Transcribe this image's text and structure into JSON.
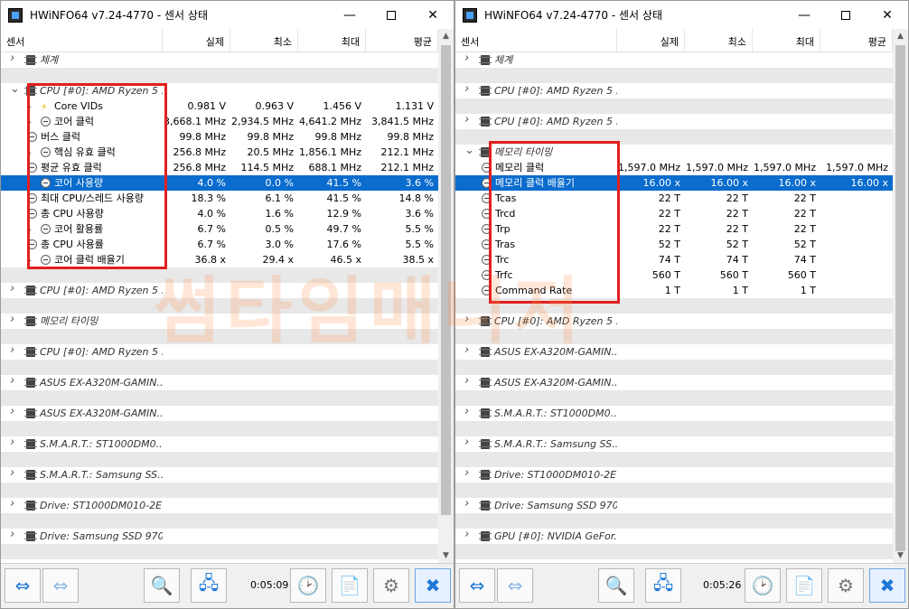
{
  "left": {
    "title": "HWiNFO64 v7.24-4770 - 센서 상태",
    "columns": [
      "센서",
      "실제",
      "최소",
      "최대",
      "평균"
    ],
    "time": "0:05:09",
    "rows": [
      {
        "kind": "group",
        "label": "체계",
        "expand": ">"
      },
      {
        "kind": "gap"
      },
      {
        "kind": "group",
        "label": "CPU [#0]: AMD Ryzen 5 ...",
        "expand": "v"
      },
      {
        "kind": "item",
        "icon": "bolt",
        "indent": 2,
        "label": "Core VIDs",
        "v": [
          "0.981 V",
          "0.963 V",
          "1.456 V",
          "1.131 V"
        ]
      },
      {
        "kind": "item",
        "icon": "circle",
        "indent": 2,
        "label": "코어 클럭",
        "v": [
          "3,668.1 MHz",
          "2,934.5 MHz",
          "4,641.2 MHz",
          "3,841.5 MHz"
        ]
      },
      {
        "kind": "item",
        "icon": "circle",
        "indent": 1,
        "label": "버스 클럭",
        "v": [
          "99.8 MHz",
          "99.8 MHz",
          "99.8 MHz",
          "99.8 MHz"
        ]
      },
      {
        "kind": "item",
        "icon": "circle",
        "indent": 2,
        "label": "핵심 유효 클럭",
        "v": [
          "256.8 MHz",
          "20.5 MHz",
          "1,856.1 MHz",
          "212.1 MHz"
        ]
      },
      {
        "kind": "item",
        "icon": "circle",
        "indent": 1,
        "label": "평균 유효 클럭",
        "v": [
          "256.8 MHz",
          "114.5 MHz",
          "688.1 MHz",
          "212.1 MHz"
        ]
      },
      {
        "kind": "item",
        "icon": "circle",
        "indent": 2,
        "label": "코어 사용량",
        "sel": true,
        "v": [
          "4.0 %",
          "0.0 %",
          "41.5 %",
          "3.6 %"
        ]
      },
      {
        "kind": "item",
        "icon": "circle",
        "indent": 1,
        "label": "최대 CPU/스레드 사용량",
        "v": [
          "18.3 %",
          "6.1 %",
          "41.5 %",
          "14.8 %"
        ]
      },
      {
        "kind": "item",
        "icon": "circle",
        "indent": 1,
        "label": "총 CPU 사용량",
        "v": [
          "4.0 %",
          "1.6 %",
          "12.9 %",
          "3.6 %"
        ]
      },
      {
        "kind": "item",
        "icon": "circle",
        "indent": 2,
        "label": "코어 활용률",
        "v": [
          "6.7 %",
          "0.5 %",
          "49.7 %",
          "5.5 %"
        ]
      },
      {
        "kind": "item",
        "icon": "circle",
        "indent": 1,
        "label": "총 CPU 사용률",
        "v": [
          "6.7 %",
          "3.0 %",
          "17.6 %",
          "5.5 %"
        ]
      },
      {
        "kind": "item",
        "icon": "circle",
        "indent": 2,
        "label": "코어 클럭 배율기",
        "v": [
          "36.8 x",
          "29.4 x",
          "46.5 x",
          "38.5 x"
        ]
      },
      {
        "kind": "gap"
      },
      {
        "kind": "group",
        "label": "CPU [#0]: AMD Ryzen 5 ...",
        "expand": ">"
      },
      {
        "kind": "gap"
      },
      {
        "kind": "group",
        "label": "메모리 타이밍",
        "expand": ">"
      },
      {
        "kind": "gap"
      },
      {
        "kind": "group",
        "label": "CPU [#0]: AMD Ryzen 5 ...",
        "expand": ">"
      },
      {
        "kind": "gap"
      },
      {
        "kind": "group",
        "label": "ASUS EX-A320M-GAMIN...",
        "expand": ">"
      },
      {
        "kind": "gap"
      },
      {
        "kind": "group",
        "label": "ASUS EX-A320M-GAMIN...",
        "expand": ">"
      },
      {
        "kind": "gap"
      },
      {
        "kind": "group",
        "label": "S.M.A.R.T.: ST1000DM0...",
        "expand": ">"
      },
      {
        "kind": "gap"
      },
      {
        "kind": "group",
        "label": "S.M.A.R.T.: Samsung SS...",
        "expand": ">"
      },
      {
        "kind": "gap"
      },
      {
        "kind": "group",
        "label": "Drive: ST1000DM010-2E...",
        "expand": ">"
      },
      {
        "kind": "gap"
      },
      {
        "kind": "group",
        "label": "Drive: Samsung SSD 970 ...",
        "expand": ">"
      },
      {
        "kind": "gap"
      }
    ]
  },
  "right": {
    "title": "HWiNFO64 v7.24-4770 - 센서 상태",
    "columns": [
      "센서",
      "실제",
      "최소",
      "최대",
      "평균"
    ],
    "time": "0:05:26",
    "rows": [
      {
        "kind": "group",
        "label": "체계",
        "expand": ">"
      },
      {
        "kind": "gap"
      },
      {
        "kind": "group",
        "label": "CPU [#0]: AMD Ryzen 5 ...",
        "expand": ">"
      },
      {
        "kind": "gap"
      },
      {
        "kind": "group",
        "label": "CPU [#0]: AMD Ryzen 5 ...",
        "expand": ">"
      },
      {
        "kind": "gap"
      },
      {
        "kind": "group",
        "label": "메모리 타이밍",
        "expand": "v"
      },
      {
        "kind": "item",
        "icon": "circle",
        "indent": 1,
        "label": "메모리 클럭",
        "v": [
          "1,597.0 MHz",
          "1,597.0 MHz",
          "1,597.0 MHz",
          "1,597.0 MHz"
        ]
      },
      {
        "kind": "item",
        "icon": "circle",
        "indent": 1,
        "label": "메모리 클럭 배율기",
        "sel": true,
        "v": [
          "16.00 x",
          "16.00 x",
          "16.00 x",
          "16.00 x"
        ]
      },
      {
        "kind": "item",
        "icon": "circle",
        "indent": 1,
        "label": "Tcas",
        "v": [
          "22 T",
          "22 T",
          "22 T",
          ""
        ]
      },
      {
        "kind": "item",
        "icon": "circle",
        "indent": 1,
        "label": "Trcd",
        "v": [
          "22 T",
          "22 T",
          "22 T",
          ""
        ]
      },
      {
        "kind": "item",
        "icon": "circle",
        "indent": 1,
        "label": "Trp",
        "v": [
          "22 T",
          "22 T",
          "22 T",
          ""
        ]
      },
      {
        "kind": "item",
        "icon": "circle",
        "indent": 1,
        "label": "Tras",
        "v": [
          "52 T",
          "52 T",
          "52 T",
          ""
        ]
      },
      {
        "kind": "item",
        "icon": "circle",
        "indent": 1,
        "label": "Trc",
        "v": [
          "74 T",
          "74 T",
          "74 T",
          ""
        ]
      },
      {
        "kind": "item",
        "icon": "circle",
        "indent": 1,
        "label": "Trfc",
        "v": [
          "560 T",
          "560 T",
          "560 T",
          ""
        ]
      },
      {
        "kind": "item",
        "icon": "circle",
        "indent": 1,
        "label": "Command Rate",
        "v": [
          "1 T",
          "1 T",
          "1 T",
          ""
        ]
      },
      {
        "kind": "gap"
      },
      {
        "kind": "group",
        "label": "CPU [#0]: AMD Ryzen 5 ...",
        "expand": ">"
      },
      {
        "kind": "gap"
      },
      {
        "kind": "group",
        "label": "ASUS EX-A320M-GAMIN...",
        "expand": ">"
      },
      {
        "kind": "gap"
      },
      {
        "kind": "group",
        "label": "ASUS EX-A320M-GAMIN...",
        "expand": ">"
      },
      {
        "kind": "gap"
      },
      {
        "kind": "group",
        "label": "S.M.A.R.T.: ST1000DM0...",
        "expand": ">"
      },
      {
        "kind": "gap"
      },
      {
        "kind": "group",
        "label": "S.M.A.R.T.: Samsung SS...",
        "expand": ">"
      },
      {
        "kind": "gap"
      },
      {
        "kind": "group",
        "label": "Drive: ST1000DM010-2E...",
        "expand": ">"
      },
      {
        "kind": "gap"
      },
      {
        "kind": "group",
        "label": "Drive: Samsung SSD 970 ...",
        "expand": ">"
      },
      {
        "kind": "gap"
      },
      {
        "kind": "group",
        "label": "GPU [#0]: NVIDIA GeFor...",
        "expand": ">"
      },
      {
        "kind": "gap"
      }
    ]
  },
  "colors": {
    "selection": "#0a6ccd",
    "highlight_box": "#e02020",
    "gap_row": "#e8e8e8"
  }
}
